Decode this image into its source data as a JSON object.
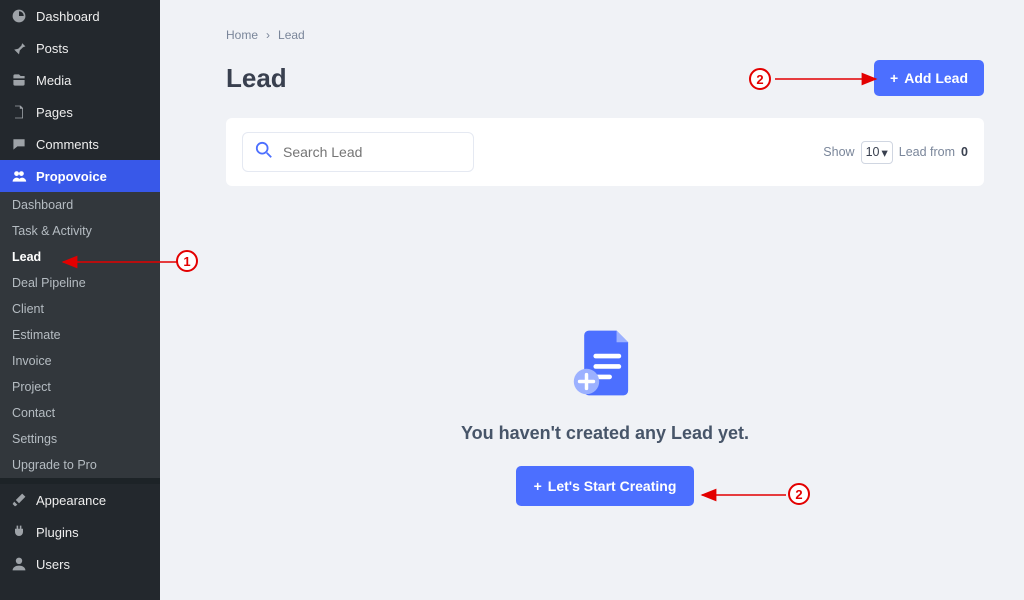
{
  "sidebar": {
    "top_items": [
      {
        "label": "Dashboard",
        "icon": "dashboard"
      },
      {
        "label": "Posts",
        "icon": "pin"
      },
      {
        "label": "Media",
        "icon": "media"
      },
      {
        "label": "Pages",
        "icon": "page"
      },
      {
        "label": "Comments",
        "icon": "comment"
      },
      {
        "label": "Propovoice",
        "icon": "group"
      }
    ],
    "submenu": [
      {
        "label": "Dashboard"
      },
      {
        "label": "Task & Activity"
      },
      {
        "label": "Lead"
      },
      {
        "label": "Deal Pipeline"
      },
      {
        "label": "Client"
      },
      {
        "label": "Estimate"
      },
      {
        "label": "Invoice"
      },
      {
        "label": "Project"
      },
      {
        "label": "Contact"
      },
      {
        "label": "Settings"
      },
      {
        "label": "Upgrade to Pro"
      }
    ],
    "bottom_items": [
      {
        "label": "Appearance",
        "icon": "brush"
      },
      {
        "label": "Plugins",
        "icon": "plug"
      },
      {
        "label": "Users",
        "icon": "user"
      }
    ]
  },
  "breadcrumb": {
    "home": "Home",
    "sep": "›",
    "current": "Lead"
  },
  "page": {
    "title": "Lead"
  },
  "actions": {
    "add": "Add Lead",
    "start": "Let's Start Creating"
  },
  "search": {
    "placeholder": "Search Lead"
  },
  "pagination": {
    "show_label": "Show",
    "per_page": "10",
    "entity": "Lead from",
    "total": "0"
  },
  "empty": {
    "message": "You haven't created any Lead yet."
  },
  "annotations": {
    "one": "1",
    "two": "2"
  }
}
